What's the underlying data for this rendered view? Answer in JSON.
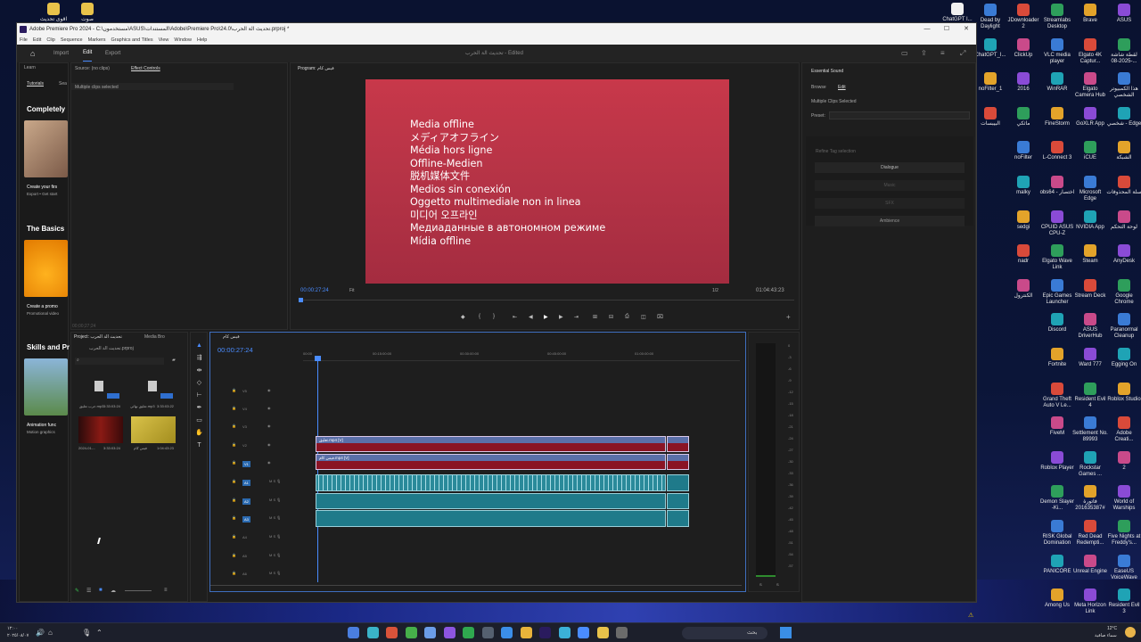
{
  "window": {
    "title": "Adobe Premiere Pro 2024 - C:\\مستخدمون\\ASUS\\المستندات\\Adobe\\Premiere Pro\\24.0\\تحديث الة الحرب.prproj *",
    "minimize": "—",
    "maximize": "☐",
    "close": "✕"
  },
  "menu": [
    "File",
    "Edit",
    "Clip",
    "Sequence",
    "Markers",
    "Graphics and Titles",
    "View",
    "Window",
    "Help"
  ],
  "workspace": {
    "tabs": [
      "Import",
      "Edit",
      "Export"
    ],
    "active": "Edit",
    "project_title": "تحديث الة الحرب - Edited"
  },
  "learn": {
    "header": "Learn",
    "tabs": [
      "Tutorials",
      "Sea"
    ],
    "sections": [
      {
        "heading": "Completely",
        "item_title": "Create your firs",
        "item_sub": "Export • Get start"
      },
      {
        "heading": "The Basics",
        "item_title": "Create a promo",
        "item_sub": "Promotional video"
      },
      {
        "heading": "Skills and Pr",
        "item_title": "Animation func",
        "item_sub": "Motion graphics"
      }
    ]
  },
  "source": {
    "tabs": [
      "Source: (no clips)",
      "Effect Controls"
    ],
    "message": "Multiple clips selected",
    "timecode": "00;00;27;24"
  },
  "program": {
    "title": "Program: فيس كام",
    "timecode": "00:00:27:24",
    "fit": "Fit",
    "ratio": "1/2",
    "duration": "01:04:43:23",
    "offline_lines": [
      "Media offline",
      "メディアオフライン",
      "Média hors ligne",
      "Offline-Medien",
      "脱机媒体文件",
      "Medios sin conexión",
      "Oggetto multimediale non in linea",
      "미디어 오프라인",
      "Медиаданные в автономном режиме",
      "Mídia offline"
    ]
  },
  "essential_sound": {
    "header": "Essential Sound",
    "tabs": [
      "Browse",
      "Edit"
    ],
    "selected": "Multiple Clips Selected",
    "preset_label": "Preset:",
    "refine": "Refine Tag selection",
    "buttons": [
      "Dialogue",
      "Music",
      "SFX",
      "Ambience"
    ]
  },
  "project": {
    "header": "Project: تحديث الة الحرب",
    "tab2": "Media Bro",
    "file": "تحديث الة الحرب.prproj",
    "items": [
      {
        "name": "حرب تعليق.mp3",
        "dur": "3:33:03:24"
      },
      {
        "name": "تعليق نهائي.mp3",
        "dur": "3:33:03:22"
      },
      {
        "name": "2024-01-...",
        "dur": "3:33:03:24"
      },
      {
        "name": "فيس كام",
        "dur": "1:04:43:23"
      }
    ]
  },
  "timeline": {
    "tab": "فيس كام",
    "timecode": "00:00:27:24",
    "ruler": [
      "00:00",
      "00:15:00:00",
      "00:30:00:00",
      "00:45:00:00",
      "01:00:00:00"
    ],
    "video_tracks": [
      "V5",
      "V4",
      "V3",
      "V2",
      "V1"
    ],
    "audio_tracks": [
      "A1",
      "A2",
      "A3",
      "A4",
      "A5",
      "A6"
    ],
    "clip_v2": "تعليق.mp4 [V]",
    "clip_v1": "فيس كام.mp4 [V]"
  },
  "meter_scale": [
    "0",
    "-3",
    "-6",
    "-9",
    "-12",
    "-15",
    "-18",
    "-21",
    "-24",
    "-27",
    "-30",
    "-33",
    "-36",
    "-39",
    "-42",
    "-45",
    "-48",
    "-51",
    "-54",
    "-57"
  ],
  "meter_foot": [
    "S",
    "S"
  ],
  "desktop_right": [
    [
      "Dead by Daylight",
      "JDownloader 2",
      "Streamlabs Desktop",
      "Brave",
      "ASUS"
    ],
    [
      "ChatGPT_I...",
      "ClickUp",
      "VLC media player",
      "Elgato 4K Captur...",
      "لقطة شاشة 2025-08-..."
    ],
    [
      "noFilter_1",
      "2016",
      "WinRAR",
      "Elgato Camera Hub",
      "هذا الكمبيوتر الشخصي"
    ],
    [
      "البيبسات",
      "ماثكي",
      "FineStorm",
      "GoXLR App",
      "شخصي - Edge"
    ],
    [
      "",
      "noFilter",
      "L-Connect 3",
      "iCUE",
      "الشبكة"
    ],
    [
      "",
      "malky",
      "obs64 - اختصار",
      "Microsoft Edge",
      "سلة المحذوفات"
    ],
    [
      "",
      "sedgi",
      "CPUID ASUS CPU-Z",
      "NVIDIA App",
      "لوحة التحكم"
    ],
    [
      "",
      "nadr",
      "Elgato Wave Link",
      "Steam",
      "AnyDesk"
    ],
    [
      "",
      "الكنترول",
      "Epic Games Launcher",
      "Stream Deck",
      "Google Chrome"
    ],
    [
      "",
      "",
      "Discord",
      "ASUS DriverHub",
      "Paranormal Cleanup"
    ],
    [
      "",
      "",
      "Fortnite",
      "Ward 777",
      "Egging On"
    ],
    [
      "",
      "",
      "Grand Theft Auto V Le...",
      "Resident Evil 4",
      "Roblox Studio"
    ],
    [
      "",
      "",
      "FiveM",
      "Settlement No. 89993",
      "Adobe Creati..."
    ],
    [
      "",
      "",
      "Roblox Player",
      "Rockstar Games ...",
      "2"
    ],
    [
      "",
      "",
      "Demon Slayer -Ki...",
      "فاتورة #201635387",
      "World of Warships"
    ],
    [
      "",
      "",
      "RISK Global Domination",
      "Red Dead Redempti...",
      "Five Nights at Freddy's..."
    ],
    [
      "",
      "",
      "PANICORE",
      "Unreal Engine",
      "EaseUS VoiceWave"
    ],
    [
      "",
      "",
      "Among Us",
      "Meta Horizon Link",
      "Resident Evil 3"
    ]
  ],
  "desktop_top": [
    "اقوى تحديث",
    "صوت"
  ],
  "desktop_top_right": "ChatGPT I...",
  "taskbar": {
    "search": "بحث",
    "clock": "١٢:٠٠",
    "date": "٢٠٢٥/٠٨/٠٧",
    "weather": "12°C",
    "weather_sub": "سماء صافية"
  }
}
